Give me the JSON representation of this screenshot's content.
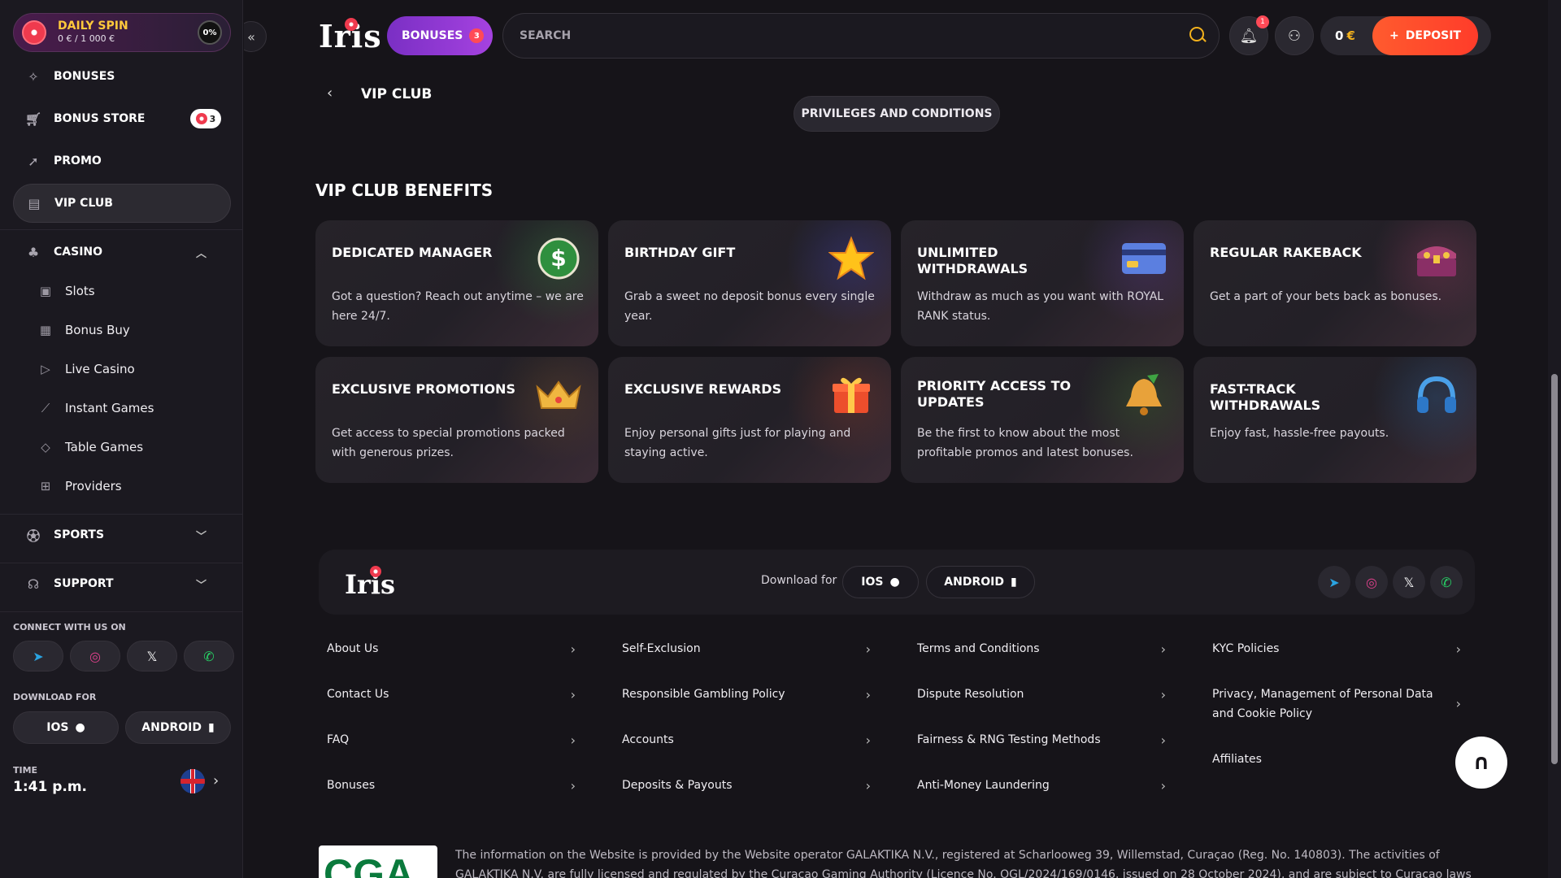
{
  "sidebar": {
    "daily_spin": {
      "title": "DAILY SPIN",
      "progress_text": "0 € / 1 000 €",
      "percent": "0%"
    },
    "items": [
      {
        "label": "BONUSES",
        "icon": "gift-icon"
      },
      {
        "label": "BONUS STORE",
        "icon": "cart-icon",
        "badge": "3"
      },
      {
        "label": "PROMO",
        "icon": "rocket-icon"
      },
      {
        "label": "VIP CLUB",
        "icon": "vip-icon",
        "active": true
      }
    ],
    "casino": {
      "label": "CASINO",
      "sub_items": [
        {
          "label": "Slots",
          "icon": "slot-icon"
        },
        {
          "label": "Bonus Buy",
          "icon": "gift-box-icon"
        },
        {
          "label": "Live Casino",
          "icon": "play-icon"
        },
        {
          "label": "Instant Games",
          "icon": "chart-icon"
        },
        {
          "label": "Table Games",
          "icon": "diamond-icon"
        },
        {
          "label": "Providers",
          "icon": "grid-icon"
        }
      ]
    },
    "sports": {
      "label": "SPORTS"
    },
    "support": {
      "label": "SUPPORT"
    },
    "connect_label": "CONNECT WITH US ON",
    "download_label": "DOWNLOAD FOR",
    "ios_label": "IOS",
    "android_label": "ANDROID",
    "time_label": "TIME",
    "time_value": "1:41 p.m."
  },
  "header": {
    "logo": "Iris",
    "bonuses_label": "BONUSES",
    "bonuses_count": "3",
    "search_placeholder": "SEARCH",
    "notification_count": "1",
    "balance": "0",
    "currency": "€",
    "deposit_label": "DEPOSIT"
  },
  "vip": {
    "breadcrumb": "VIP CLUB",
    "privileges_button": "PRIVILEGES AND CONDITIONS",
    "benefits_title": "VIP CLUB BENEFITS",
    "cards": [
      {
        "title": "DEDICATED MANAGER",
        "desc": "Got a question? Reach out anytime – we are here 24/7.",
        "icon": "coin-dollar-icon",
        "accent": "#2e7d3a"
      },
      {
        "title": "BIRTHDAY GIFT",
        "desc": "Grab a sweet no deposit bonus every single year.",
        "icon": "star-icon",
        "accent": "#3a3ea8"
      },
      {
        "title": "UNLIMITED WITHDRAWALS",
        "desc": "Withdraw as much as you want with ROYAL RANK status.",
        "icon": "credit-card-icon",
        "accent": "#5a3d8f"
      },
      {
        "title": "REGULAR RAKEBACK",
        "desc": "Get a part of your bets back as bonuses.",
        "icon": "treasure-chest-icon",
        "accent": "#8a3a5c"
      },
      {
        "title": "EXCLUSIVE PROMOTIONS",
        "desc": "Get access to special promotions packed with generous prizes.",
        "icon": "crown-icon",
        "accent": "#6b4a2a"
      },
      {
        "title": "EXCLUSIVE REWARDS",
        "desc": "Enjoy personal gifts just for playing and staying active.",
        "icon": "gift-icon",
        "accent": "#8a3a2a"
      },
      {
        "title": "PRIORITY ACCESS TO UPDATES",
        "desc": "Be the first to know about the most profitable promos and latest bonuses.",
        "icon": "bell-icon",
        "accent": "#3a6b2a"
      },
      {
        "title": "FAST-TRACK WITHDRAWALS",
        "desc": "Enjoy fast, hassle-free payouts.",
        "icon": "headphones-icon",
        "accent": "#2a5a8a"
      }
    ]
  },
  "footer": {
    "logo": "Iris",
    "download_for": "Download for",
    "ios_label": "IOS",
    "android_label": "ANDROID",
    "columns": [
      [
        "About Us",
        "Contact Us",
        "FAQ",
        "Bonuses"
      ],
      [
        "Self-Exclusion",
        "Responsible Gambling Policy",
        "Accounts",
        "Deposits & Payouts"
      ],
      [
        "Terms and Conditions",
        "Dispute Resolution",
        "Fairness & RNG Testing Methods",
        "Anti-Money Laundering"
      ],
      [
        "KYC Policies",
        "Privacy, Management of Personal Data and Cookie Policy",
        "Affiliates"
      ]
    ],
    "cga_text": "CGA",
    "legal": "The information on the Website is provided by the Website operator GALAKTIKA N.V., registered at Scharlooweg 39, Willemstad, Curaçao (Reg. No. 140803). The activities of GALAKTIKA N.V. are fully licensed and regulated by the Curacao Gaming Authority (Licence No. OGL/2024/169/0146, issued on 28 October 2024), and are subject to Curacao laws"
  }
}
